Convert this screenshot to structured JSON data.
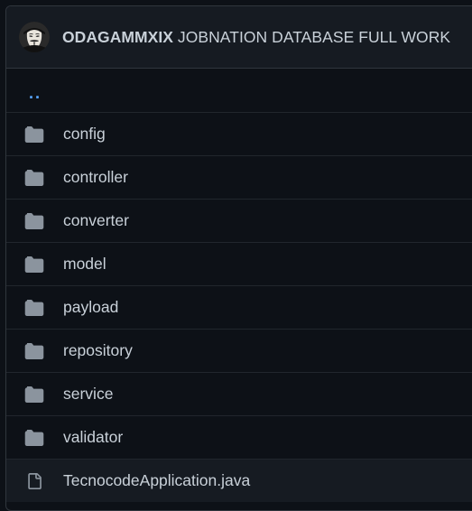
{
  "header": {
    "author": "ODAGAMMXIX",
    "commit_message": "JOBNATION DATABASE FULL WORK"
  },
  "parent_dir": {
    "label": ".."
  },
  "entries": [
    {
      "name": "config",
      "type": "folder",
      "icon": "folder-icon"
    },
    {
      "name": "controller",
      "type": "folder",
      "icon": "folder-icon"
    },
    {
      "name": "converter",
      "type": "folder",
      "icon": "folder-icon"
    },
    {
      "name": "model",
      "type": "folder",
      "icon": "folder-icon"
    },
    {
      "name": "payload",
      "type": "folder",
      "icon": "folder-icon"
    },
    {
      "name": "repository",
      "type": "folder",
      "icon": "folder-icon"
    },
    {
      "name": "service",
      "type": "folder",
      "icon": "folder-icon"
    },
    {
      "name": "validator",
      "type": "folder",
      "icon": "folder-icon"
    },
    {
      "name": "TecnocodeApplication.java",
      "type": "file",
      "icon": "file-icon"
    }
  ],
  "colors": {
    "background": "#0d1117",
    "header_bg": "#161b22",
    "border": "#30363d",
    "text": "#c9d1d9",
    "icon": "#8b949e",
    "link": "#58a6ff"
  }
}
